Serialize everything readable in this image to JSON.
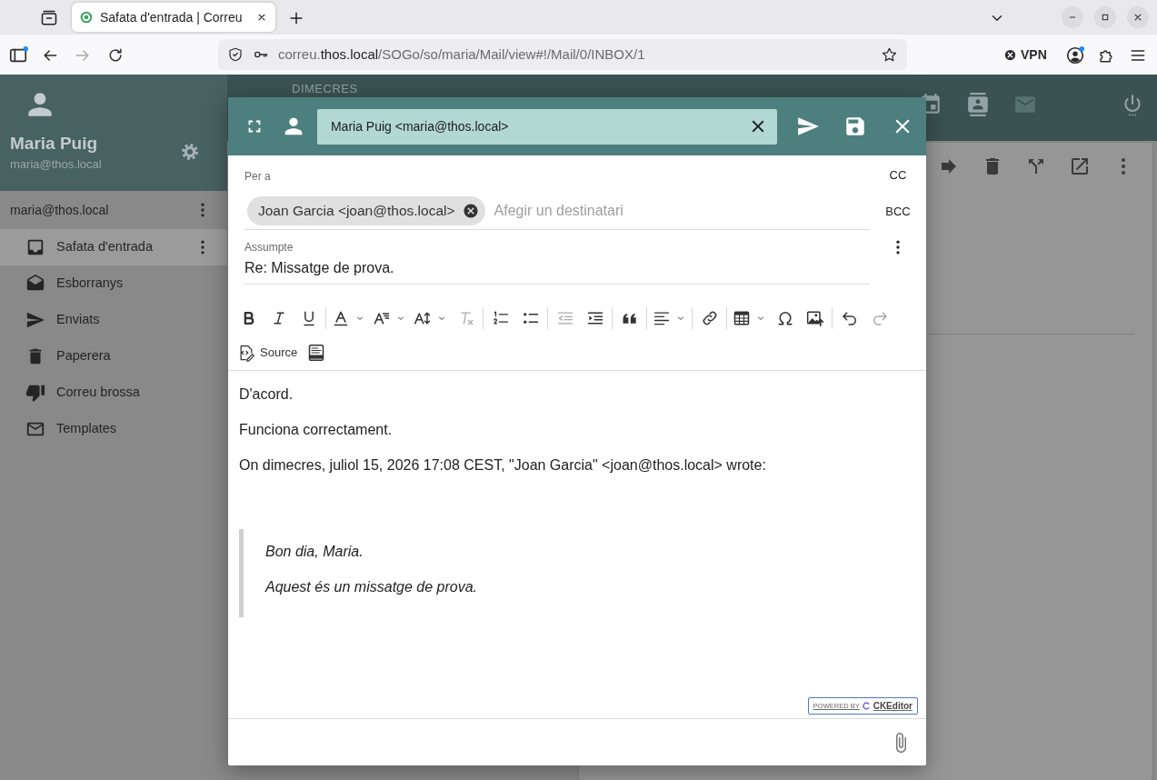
{
  "browser": {
    "tab": {
      "title": "Safata d'entrada | Correu",
      "selected": true
    },
    "url_parts": [
      {
        "text": "correu.",
        "emphasized": false
      },
      {
        "text": "thos.local",
        "emphasized": true
      },
      {
        "text": "/SOGo/so/maria/Mail/view#!/Mail/0/INBOX/1",
        "emphasized": false
      }
    ],
    "vpn": "VPN"
  },
  "sidebar": {
    "user_name": "Maria Puig",
    "user_email": "maria@thos.local",
    "account": "maria@thos.local",
    "folders": [
      {
        "kind": "inbox",
        "label": "Safata d'entrada",
        "selected": true
      },
      {
        "kind": "drafts",
        "label": "Esborranys",
        "selected": false
      },
      {
        "kind": "sent",
        "label": "Enviats",
        "selected": false
      },
      {
        "kind": "trash",
        "label": "Paperera",
        "selected": false
      },
      {
        "kind": "junk",
        "label": "Correu brossa",
        "selected": false
      },
      {
        "kind": "templates",
        "label": "Templates",
        "selected": false
      }
    ]
  },
  "calendar_header": {
    "day": "DIMECRES"
  },
  "app_nav": [
    {
      "kind": "calendar",
      "selected": false
    },
    {
      "kind": "contacts",
      "selected": false
    },
    {
      "kind": "mail",
      "selected": true
    }
  ],
  "compose": {
    "from": "Maria Puig <maria@thos.local>",
    "to_label": "Per a",
    "recipients": [
      {
        "label": "Joan Garcia <joan@thos.local>"
      }
    ],
    "to_placeholder": "Afegir un destinatari",
    "cc": "CC",
    "bcc": "BCC",
    "subject_label": "Assumpte",
    "subject": "Re: Missatge de prova.",
    "toolbar": [
      [
        {
          "kind": "bold",
          "disabled": false,
          "dropdown": false
        },
        {
          "kind": "italic",
          "disabled": false,
          "dropdown": false
        },
        {
          "kind": "underline",
          "disabled": false,
          "dropdown": false
        },
        {
          "kind": "separator"
        },
        {
          "kind": "font_color",
          "disabled": false,
          "dropdown": true
        },
        {
          "kind": "font_family",
          "disabled": false,
          "dropdown": true
        },
        {
          "kind": "font_size",
          "disabled": false,
          "dropdown": true
        },
        {
          "kind": "remove_format",
          "disabled": true,
          "dropdown": false
        },
        {
          "kind": "separator"
        },
        {
          "kind": "numbered_list",
          "disabled": false,
          "dropdown": false
        },
        {
          "kind": "bulleted_list",
          "disabled": false,
          "dropdown": false
        },
        {
          "kind": "separator"
        },
        {
          "kind": "outdent",
          "disabled": true,
          "dropdown": false
        },
        {
          "kind": "indent",
          "disabled": false,
          "dropdown": false
        },
        {
          "kind": "separator"
        },
        {
          "kind": "blockquote",
          "disabled": false,
          "dropdown": false
        },
        {
          "kind": "separator"
        },
        {
          "kind": "alignment",
          "disabled": false,
          "dropdown": true
        },
        {
          "kind": "separator"
        },
        {
          "kind": "link",
          "disabled": false,
          "dropdown": false
        },
        {
          "kind": "separator"
        },
        {
          "kind": "table",
          "disabled": false,
          "dropdown": true
        },
        {
          "kind": "special_characters",
          "disabled": false,
          "dropdown": false
        },
        {
          "kind": "image_upload",
          "disabled": false,
          "dropdown": false
        },
        {
          "kind": "separator"
        },
        {
          "kind": "undo",
          "disabled": false,
          "dropdown": false
        },
        {
          "kind": "redo",
          "disabled": true,
          "dropdown": false
        }
      ],
      [
        {
          "kind": "source",
          "label": "Source",
          "disabled": false,
          "dropdown": false
        },
        {
          "kind": "html",
          "disabled": false,
          "dropdown": false
        }
      ]
    ],
    "body": [
      "D'acord.",
      "Funciona correctament."
    ],
    "quote_intro": "On dimecres, juliol 15, 2026 17:08 CEST, \"Joan Garcia\" <joan@thos.local> wrote:",
    "quote": [
      "Bon dia, Maria.",
      "Aquest és un missatge de prova."
    ],
    "powered_by": "POWERED BY",
    "editor_brand": "CKEditor"
  }
}
